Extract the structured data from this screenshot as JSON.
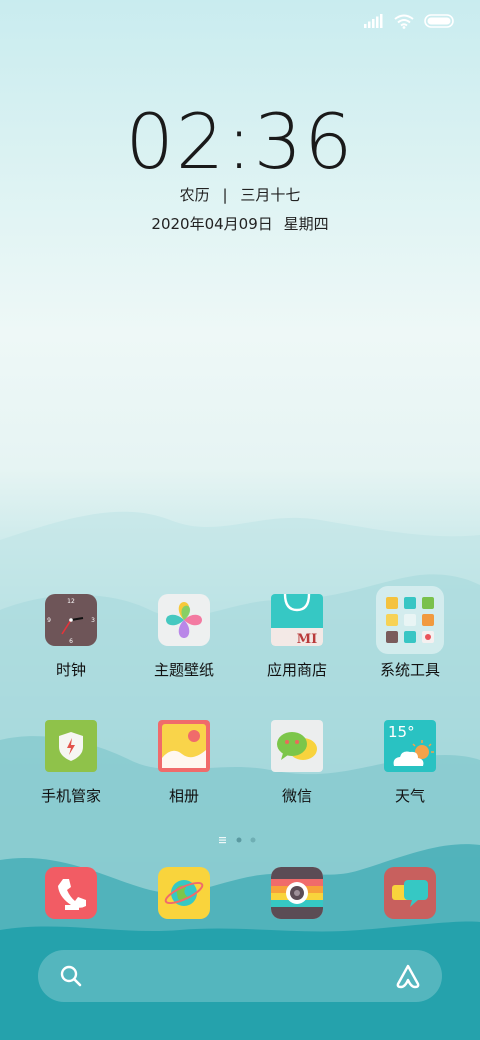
{
  "status_bar": {
    "icons": [
      "signal-icon",
      "wifi-icon",
      "battery-icon"
    ]
  },
  "clock": {
    "time": "02:36",
    "lunar_label": "农历",
    "lunar_sep": "|",
    "lunar_date": "三月十七",
    "date": "2020年04月09日",
    "weekday": "星期四"
  },
  "apps_row1": [
    {
      "label": "时钟",
      "icon": "clock-icon"
    },
    {
      "label": "主题壁纸",
      "icon": "theme-wallpaper-icon"
    },
    {
      "label": "应用商店",
      "icon": "app-store-icon"
    },
    {
      "label": "系统工具",
      "icon": "system-tools-folder-icon"
    }
  ],
  "apps_row2": [
    {
      "label": "手机管家",
      "icon": "security-icon"
    },
    {
      "label": "相册",
      "icon": "gallery-icon"
    },
    {
      "label": "微信",
      "icon": "wechat-icon"
    },
    {
      "label": "天气",
      "icon": "weather-icon"
    }
  ],
  "clock_icon": {
    "n12": "12",
    "n3": "3",
    "n6": "6",
    "n9": "9"
  },
  "appstore_icon": {
    "text": "MI"
  },
  "weather_icon": {
    "temp": "15°"
  },
  "page_indicator": {
    "pages": 3,
    "current": 1
  },
  "dock": [
    "phone-icon",
    "browser-icon",
    "camera-icon",
    "messages-icon"
  ],
  "search_bar": {
    "left_icon": "search-icon",
    "right_icon": "assistant-icon"
  },
  "colors": {
    "clock_bg": "#6e5558",
    "store_bg": "#36c8c4",
    "security_bg": "#8fc24a",
    "gallery_bg": "#f06b6b",
    "weather_bg": "#29c2c2",
    "phone_bg": "#f25c64",
    "browser_bg": "#f9d43c",
    "messages_bg": "#c8605e"
  }
}
